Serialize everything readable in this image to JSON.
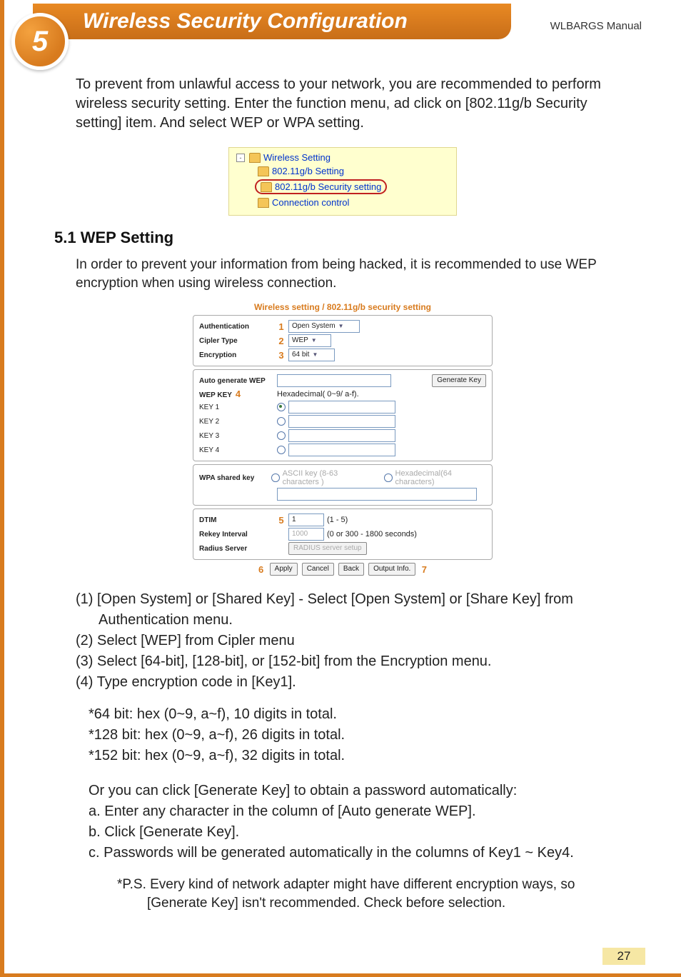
{
  "chapter_number": "5",
  "chapter_title": "Wireless Security Configuration",
  "manual_tag": "WLBARGS Manual",
  "intro": "To prevent from unlawful access to your network, you are recommended to perform wireless security setting. Enter the function menu, ad click on [802.11g/b Security setting] item. And select WEP or WPA setting.",
  "tree": {
    "root": "Wireless Setting",
    "items": [
      {
        "label": "802.11g/b Setting"
      },
      {
        "label": "802.11g/b Security setting",
        "hilite": true
      },
      {
        "label": "Connection control"
      }
    ]
  },
  "section_heading": "5.1 WEP Setting",
  "section_para": "In order to prevent your information from being hacked, it is recommended to use WEP encryption when using wireless connection.",
  "panel": {
    "title": "Wireless setting / 802.11g/b security setting",
    "auth_label": "Authentication",
    "auth_value": "Open System",
    "cipher_label": "Cipler Type",
    "cipher_value": "WEP",
    "enc_label": "Encryption",
    "enc_value": "64 bit",
    "autogen_label": "Auto generate WEP",
    "genkey_btn": "Generate Key",
    "wepkey_label": "WEP KEY",
    "wepkey_hint": "Hexadecimal( 0~9/ a-f).",
    "keys": [
      "KEY 1",
      "KEY 2",
      "KEY 3",
      "KEY 4"
    ],
    "wpa_label": "WPA shared key",
    "wpa_hint1": "ASCII key (8-63 characters )",
    "wpa_hint2": "Hexadecimal(64 characters)",
    "dtim_label": "DTIM",
    "dtim_value": "1",
    "dtim_range": "(1 - 5)",
    "rekey_label": "Rekey Interval",
    "rekey_value": "1000",
    "rekey_range": "(0 or 300 - 1800 seconds)",
    "radius_label": "Radius Server",
    "radius_btn": "RADIUS server setup",
    "btns": {
      "apply": "Apply",
      "cancel": "Cancel",
      "back": "Back",
      "output": "Output Info."
    },
    "tags": {
      "1": "1",
      "2": "2",
      "3": "3",
      "4": "4",
      "5": "5",
      "6": "6",
      "7": "7"
    }
  },
  "steps": {
    "s1a": "(1) [Open System] or [Shared Key] - Select [Open System] or [Share Key] from",
    "s1b": "Authentication menu.",
    "s2": "(2) Select [WEP] from Cipler menu",
    "s3": "(3) Select [64-bit], [128-bit], or [152-bit] from the Encryption menu.",
    "s4": "(4) Type encryption code in [Key1]."
  },
  "bitnotes": {
    "n64": "*64 bit: hex (0~9, a~f), 10 digits in total.",
    "n128": "*128 bit: hex (0~9, a~f), 26 digits in total.",
    "n152": "*152 bit: hex (0~9, a~f), 32 digits in total."
  },
  "orblock": {
    "o0": "Or you can click [Generate Key] to obtain a password automatically:",
    "oa": "a. Enter any character in the column of [Auto generate WEP].",
    "ob": "b. Click [Generate Key].",
    "oc": "c. Passwords will be generated automatically in the columns of Key1 ~ Key4."
  },
  "ps": "*P.S. Every kind of network adapter might have different encryption ways, so [Generate Key] isn't recommended. Check before selection.",
  "pagenum": "27"
}
